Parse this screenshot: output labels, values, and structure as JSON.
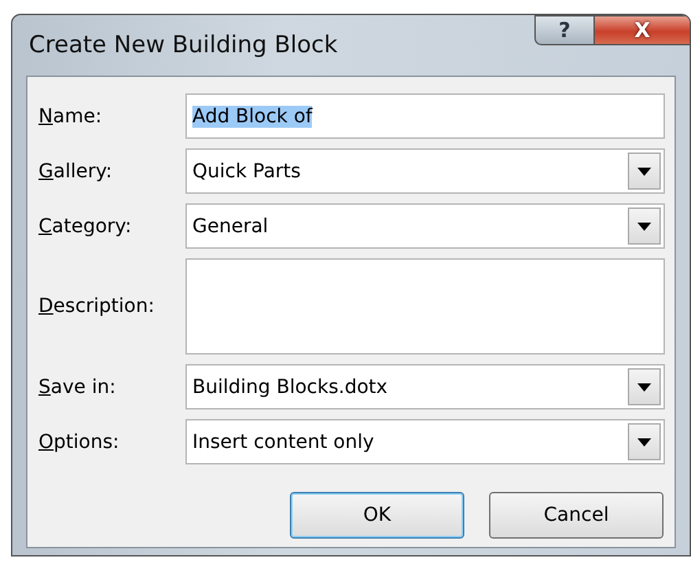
{
  "window": {
    "title": "Create New Building Block",
    "help_button": "?",
    "close_button": "X"
  },
  "fields": [
    {
      "kind": "text",
      "label": "Name:",
      "value": "Add Block of",
      "text_selected": true
    },
    {
      "kind": "dropdown",
      "label": "Gallery:",
      "value": "Quick Parts"
    },
    {
      "kind": "dropdown",
      "label": "Category:",
      "value": "General"
    },
    {
      "kind": "multiline",
      "label": "Description:"
    },
    {
      "kind": "dropdown",
      "label": "Save in:",
      "value": "Building Blocks.dotx"
    },
    {
      "kind": "dropdown",
      "label": "Options:",
      "value": "Insert content only"
    }
  ],
  "buttons": [
    {
      "label": "OK",
      "default": true
    },
    {
      "label": "Cancel",
      "default": false
    }
  ]
}
